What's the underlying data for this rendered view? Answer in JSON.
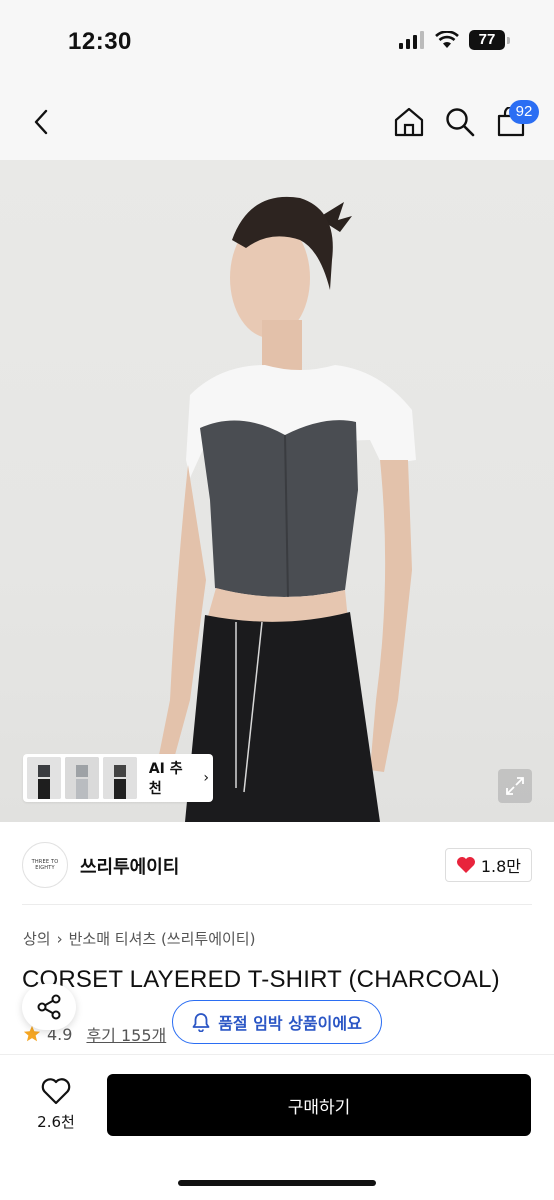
{
  "status_bar": {
    "time": "12:30",
    "battery": "77"
  },
  "nav": {
    "cart_count": "92"
  },
  "gallery": {
    "ai_recommend_label": "AI 추천",
    "chevron": "›"
  },
  "brand": {
    "name": "쓰리투에이티",
    "logo_text": "THREE TO EIGHTY",
    "likes": "1.8만"
  },
  "breadcrumb": {
    "category": "상의",
    "separator": "›",
    "subcategory": "반소매 티셔츠 (쓰리투에이티)"
  },
  "product": {
    "title": "CORSET LAYERED T-SHIRT (CHARCOAL)",
    "rating": "4.9",
    "review_label": "후기 155개"
  },
  "stock_notice": {
    "label": "품절 임박 상품이에요"
  },
  "bottom_bar": {
    "wish_count": "2.6천",
    "buy_label": "구매하기"
  },
  "colors": {
    "accent": "#2b6ef3",
    "heart": "#e8243c",
    "star": "#f5a623",
    "buy_button": "#000000"
  },
  "icons": [
    "back-icon",
    "home-icon",
    "search-icon",
    "cart-icon",
    "expand-icon",
    "heart-icon",
    "share-icon",
    "bell-icon",
    "star-icon"
  ]
}
